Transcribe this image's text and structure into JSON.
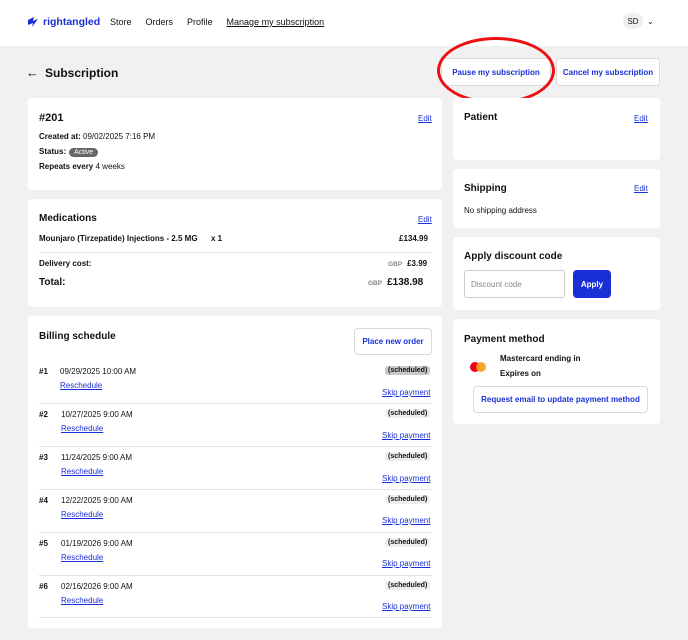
{
  "nav": {
    "logo": "rightangled",
    "items": [
      "Store",
      "Orders",
      "Profile",
      "Manage my subscription"
    ],
    "avatar": "SD",
    "chevron": "⌄"
  },
  "header": {
    "back": "←",
    "title": "Subscription",
    "pause": "Pause my subscription",
    "cancel": "Cancel my subscription"
  },
  "order": {
    "number": "#201",
    "edit": "Edit",
    "created_label": "Created at:",
    "created_value": "09/02/2025 7:16 PM",
    "status_label": "Status:",
    "status_value": "Active",
    "repeats_label": "Repeats every",
    "repeats_value": "4 weeks"
  },
  "medications": {
    "title": "Medications",
    "edit": "Edit",
    "item_name": "Mounjaro (Tirzepatide) Injections - 2.5 MG",
    "item_qty": "x 1",
    "item_price": "£134.99",
    "delivery_label": "Delivery cost:",
    "delivery_currency": "GBP",
    "delivery_value": "£3.99",
    "total_label": "Total:",
    "total_currency": "GBP",
    "total_value": "£138.98"
  },
  "billing": {
    "title": "Billing schedule",
    "new_order": "Place new order",
    "rows": [
      {
        "num": "#1",
        "date": "09/29/2025 10:00 AM",
        "status": "(scheduled)",
        "reschedule": "Reschedule",
        "skip": "Skip payment"
      },
      {
        "num": "#2",
        "date": "10/27/2025 9:00 AM",
        "status": "(scheduled)",
        "reschedule": "Reschedule",
        "skip": "Skip payment"
      },
      {
        "num": "#3",
        "date": "11/24/2025 9:00 AM",
        "status": "(scheduled)",
        "reschedule": "Reschedule",
        "skip": "Skip payment"
      },
      {
        "num": "#4",
        "date": "12/22/2025 9:00 AM",
        "status": "(scheduled)",
        "reschedule": "Reschedule",
        "skip": "Skip payment"
      },
      {
        "num": "#5",
        "date": "01/19/2026 9:00 AM",
        "status": "(scheduled)",
        "reschedule": "Reschedule",
        "skip": "Skip payment"
      },
      {
        "num": "#6",
        "date": "02/16/2026 9:00 AM",
        "status": "(scheduled)",
        "reschedule": "Reschedule",
        "skip": "Skip payment"
      }
    ]
  },
  "patient": {
    "title": "Patient",
    "edit": "Edit"
  },
  "shipping": {
    "title": "Shipping",
    "edit": "Edit",
    "value": "No shipping address"
  },
  "discount": {
    "title": "Apply discount code",
    "placeholder": "Discount code",
    "apply": "Apply"
  },
  "payment": {
    "title": "Payment method",
    "card": "Mastercard ending in",
    "expires": "Expires on",
    "request": "Request email to update payment method"
  },
  "colors": {
    "accent": "#1a2fd6",
    "annotation": "#ee1111"
  }
}
